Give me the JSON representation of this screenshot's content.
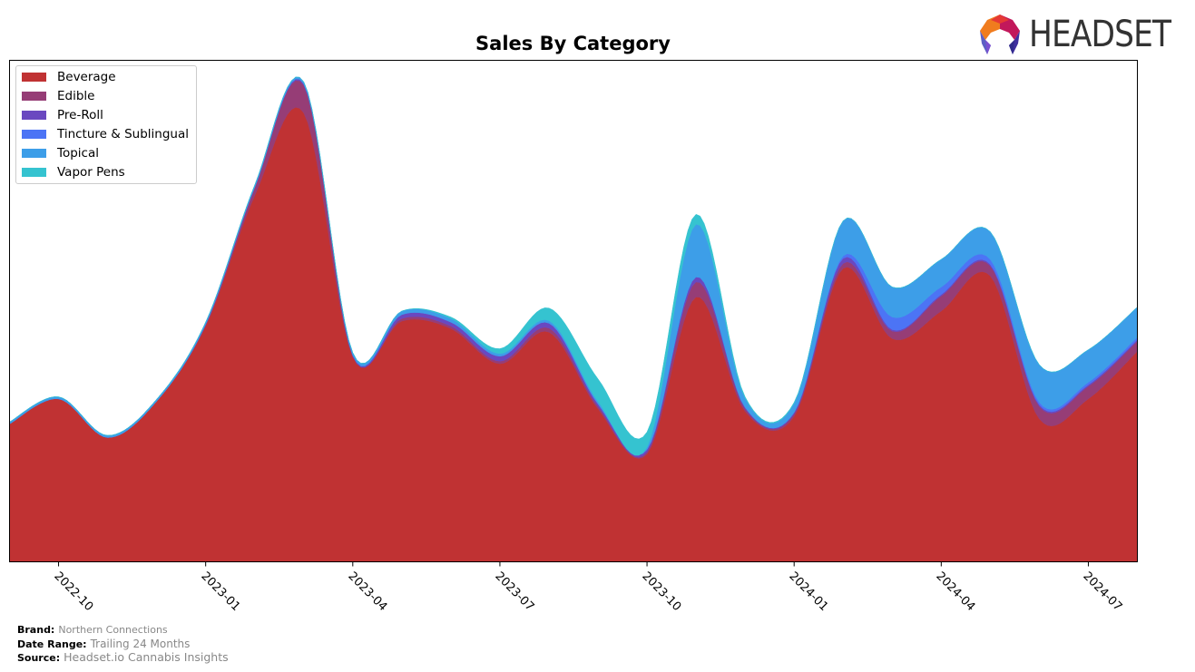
{
  "header": {
    "title": "Sales By Category",
    "logo_text": "HEADSET"
  },
  "footer": {
    "brand_label": "Brand:",
    "brand_value": "Northern Connections",
    "date_range_label": "Date Range:",
    "date_range_value": "Trailing 24 Months",
    "source_label": "Source:",
    "source_value": "Headset.io Cannabis Insights"
  },
  "chart_data": {
    "type": "area",
    "stacked": true,
    "title": "Sales By Category",
    "xlabel": "",
    "ylabel": "",
    "y_axis_visible": false,
    "ylim": [
      0,
      100
    ],
    "legend_position": "top-left",
    "grid": false,
    "x_tick_labels": [
      "2022-10",
      "2023-01",
      "2023-04",
      "2023-07",
      "2023-10",
      "2024-01",
      "2024-04",
      "2024-07"
    ],
    "x": [
      "2022-09",
      "2022-10",
      "2022-11",
      "2022-12",
      "2023-01",
      "2023-02",
      "2023-03",
      "2023-04",
      "2023-05",
      "2023-06",
      "2023-07",
      "2023-08",
      "2023-09",
      "2023-10",
      "2023-11",
      "2023-12",
      "2024-01",
      "2024-02",
      "2024-03",
      "2024-04",
      "2024-05",
      "2024-06",
      "2024-07",
      "2024-08"
    ],
    "series": [
      {
        "name": "Beverage",
        "color": "#c03233",
        "values": [
          27.5,
          32.5,
          24.8,
          32.0,
          47.0,
          73.0,
          89.5,
          40.8,
          48.0,
          46.5,
          39.5,
          45.8,
          30.5,
          21.5,
          52.8,
          30.0,
          29.0,
          58.5,
          44.5,
          50.0,
          57.0,
          28.5,
          32.5,
          42.0
        ]
      },
      {
        "name": "Edible",
        "color": "#963d76",
        "values": [
          0.0,
          0.0,
          0.0,
          0.0,
          0.3,
          1.5,
          5.5,
          0.2,
          0.5,
          0.5,
          0.5,
          0.8,
          0.5,
          0.4,
          3.0,
          0.5,
          0.5,
          1.0,
          1.5,
          3.0,
          2.0,
          2.5,
          2.5,
          2.0
        ]
      },
      {
        "name": "Pre-Roll",
        "color": "#6a48c0",
        "values": [
          0.0,
          0.0,
          0.0,
          0.0,
          0.1,
          0.2,
          0.3,
          0.2,
          0.8,
          0.8,
          1.0,
          1.0,
          0.5,
          0.5,
          1.0,
          0.3,
          0.3,
          1.0,
          0.3,
          0.3,
          0.3,
          0.3,
          0.3,
          0.3
        ]
      },
      {
        "name": "Tincture & Sublingual",
        "color": "#4c74f5",
        "values": [
          0.0,
          0.0,
          0.0,
          0.0,
          0.0,
          0.0,
          0.0,
          0.0,
          0.0,
          0.0,
          0.0,
          0.0,
          0.0,
          0.0,
          0.0,
          0.0,
          0.0,
          0.5,
          2.5,
          1.5,
          1.0,
          0.5,
          0.5,
          0.5
        ]
      },
      {
        "name": "Topical",
        "color": "#3d9ee8",
        "values": [
          0.4,
          0.4,
          0.4,
          0.4,
          0.4,
          0.4,
          0.4,
          0.5,
          0.7,
          0.7,
          0.5,
          0.5,
          0.5,
          0.5,
          10.5,
          1.8,
          1.8,
          7.0,
          6.0,
          5.5,
          5.5,
          7.5,
          6.5,
          6.0
        ]
      },
      {
        "name": "Vapor Pens",
        "color": "#35c3d0",
        "values": [
          0.0,
          0.0,
          0.0,
          0.0,
          0.0,
          0.0,
          0.0,
          0.0,
          0.0,
          0.3,
          1.0,
          2.5,
          4.5,
          3.0,
          2.0,
          0.3,
          0.2,
          0.0,
          0.0,
          0.0,
          0.0,
          0.0,
          0.0,
          0.0
        ]
      }
    ]
  }
}
